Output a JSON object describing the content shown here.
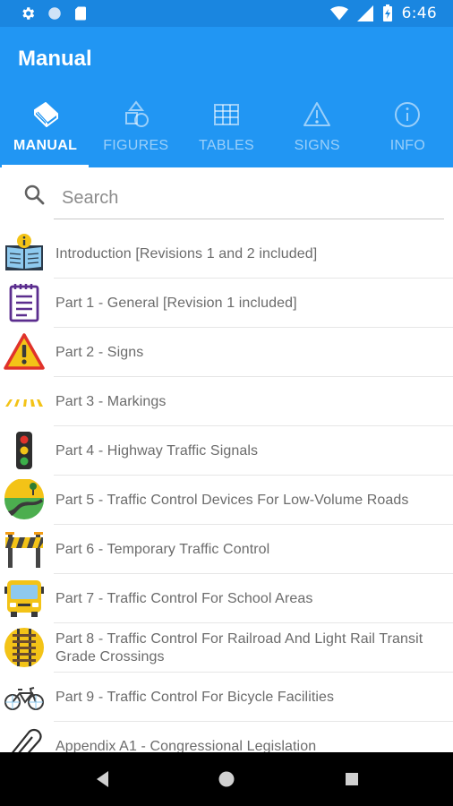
{
  "status_bar": {
    "time": "6:46",
    "icons": [
      "settings-icon",
      "circle-icon",
      "sd-card-icon",
      "wifi-icon",
      "signal-icon",
      "battery-icon"
    ]
  },
  "app": {
    "title": "Manual"
  },
  "tabs": [
    {
      "label": "MANUAL",
      "icon": "book-icon",
      "active": true
    },
    {
      "label": "FIGURES",
      "icon": "shapes-icon",
      "active": false
    },
    {
      "label": "TABLES",
      "icon": "grid-icon",
      "active": false
    },
    {
      "label": "SIGNS",
      "icon": "warning-icon",
      "active": false
    },
    {
      "label": "INFO",
      "icon": "info-icon",
      "active": false
    }
  ],
  "search": {
    "placeholder": "Search",
    "value": ""
  },
  "items": [
    {
      "label": "Introduction [Revisions 1 and 2 included]",
      "icon": "open-book-info-icon"
    },
    {
      "label": "Part 1 - General [Revision 1 included]",
      "icon": "notepad-icon"
    },
    {
      "label": "Part 2 - Signs",
      "icon": "warning-sign-icon"
    },
    {
      "label": "Part 3 - Markings",
      "icon": "road-markings-icon"
    },
    {
      "label": "Part 4 - Highway Traffic Signals",
      "icon": "traffic-light-icon"
    },
    {
      "label": "Part 5 - Traffic Control Devices For Low-Volume Roads",
      "icon": "winding-road-icon"
    },
    {
      "label": "Part 6 - Temporary Traffic Control",
      "icon": "barricade-icon"
    },
    {
      "label": "Part 7 - Traffic Control For School Areas",
      "icon": "school-bus-icon"
    },
    {
      "label": "Part 8 - Traffic Control For Railroad And Light Rail Transit Grade Crossings",
      "icon": "railroad-icon"
    },
    {
      "label": "Part 9 - Traffic Control For Bicycle Facilities",
      "icon": "bicycle-icon"
    },
    {
      "label": "Appendix A1 - Congressional Legislation",
      "icon": "paperclip-icon"
    }
  ],
  "colors": {
    "status_bar": "#1a86e0",
    "app_bar": "#2196f3",
    "text": "#6b6b6b"
  }
}
